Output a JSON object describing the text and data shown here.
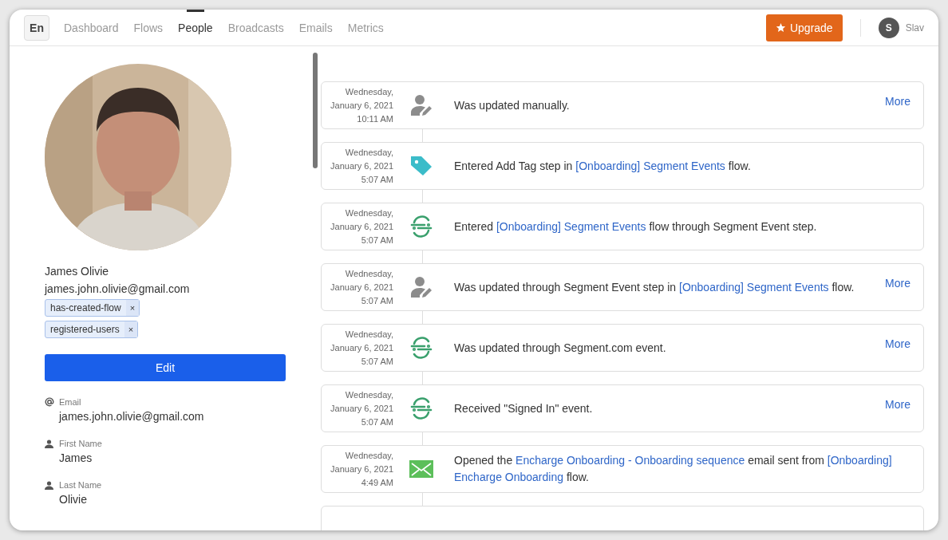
{
  "nav": {
    "language": "En",
    "tabs": [
      {
        "label": "Dashboard",
        "selected": false
      },
      {
        "label": "Flows",
        "selected": false
      },
      {
        "label": "People",
        "selected": true
      },
      {
        "label": "Broadcasts",
        "selected": false
      },
      {
        "label": "Emails",
        "selected": false
      },
      {
        "label": "Metrics",
        "selected": false
      }
    ],
    "upgrade": "Upgrade",
    "user": {
      "initial": "S",
      "name": "Slav"
    }
  },
  "profile": {
    "name": "James Olivie",
    "email": "james.john.olivie@gmail.com",
    "tags": [
      {
        "label": "has-created-flow",
        "remove": "×"
      },
      {
        "label": "registered-users",
        "remove": "×"
      }
    ],
    "edit": "Edit",
    "fields": [
      {
        "kind": "email",
        "label": "Email",
        "value": "james.john.olivie@gmail.com"
      },
      {
        "kind": "person",
        "label": "First Name",
        "value": "James"
      },
      {
        "kind": "person",
        "label": "Last Name",
        "value": "Olivie"
      }
    ]
  },
  "events": [
    {
      "kind": "manual",
      "day": "Wednesday,",
      "date": "January 6, 2021",
      "time": "10:11 AM",
      "message": [
        {
          "text": "Was updated manually.",
          "link": false
        }
      ],
      "more": "More"
    },
    {
      "kind": "tag",
      "day": "Wednesday,",
      "date": "January 6, 2021",
      "time": "5:07 AM",
      "message": [
        {
          "text": "Entered Add Tag step in ",
          "link": false
        },
        {
          "text": "[Onboarding] Segment Events",
          "link": true
        },
        {
          "text": " flow.",
          "link": false
        }
      ]
    },
    {
      "kind": "segment",
      "day": "Wednesday,",
      "date": "January 6, 2021",
      "time": "5:07 AM",
      "message": [
        {
          "text": "Entered ",
          "link": false
        },
        {
          "text": "[Onboarding] Segment Events",
          "link": true
        },
        {
          "text": " flow through Segment Event step.",
          "link": false
        }
      ]
    },
    {
      "kind": "manual",
      "day": "Wednesday,",
      "date": "January 6, 2021",
      "time": "5:07 AM",
      "message": [
        {
          "text": "Was updated through Segment Event step in ",
          "link": false
        },
        {
          "text": "[Onboarding] Segment Events",
          "link": true
        },
        {
          "text": " flow.",
          "link": false
        }
      ],
      "more": "More"
    },
    {
      "kind": "segment",
      "day": "Wednesday,",
      "date": "January 6, 2021",
      "time": "5:07 AM",
      "message": [
        {
          "text": "Was updated through Segment.com event.",
          "link": false
        }
      ],
      "more": "More"
    },
    {
      "kind": "segment",
      "day": "Wednesday,",
      "date": "January 6, 2021",
      "time": "5:07 AM",
      "message": [
        {
          "text": "Received \"Signed In\" event.",
          "link": false
        }
      ],
      "more": "More"
    },
    {
      "kind": "email",
      "day": "Wednesday,",
      "date": "January 6, 2021",
      "time": "4:49 AM",
      "message": [
        {
          "text": "Opened the ",
          "link": false
        },
        {
          "text": "Encharge Onboarding - Onboarding sequence",
          "link": true
        },
        {
          "text": " email sent from ",
          "link": false
        },
        {
          "text": "[Onboarding]",
          "link": true
        },
        {
          "text": "Encharge Onboarding",
          "link": true
        },
        {
          "text": " flow.",
          "link": false
        }
      ]
    }
  ]
}
